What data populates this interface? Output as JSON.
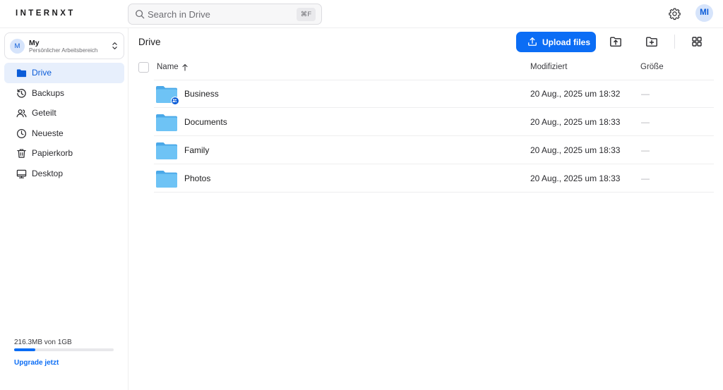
{
  "app": {
    "logo": "INTERNXT",
    "search": {
      "placeholder": "Search in Drive",
      "shortcut": "⌘F"
    },
    "user_initials": "MI",
    "icons": {
      "search": "search-icon",
      "settings": "gear-icon"
    }
  },
  "workspace": {
    "initial": "M",
    "name": "My",
    "subtitle": "Persönlicher Arbeitsbereich",
    "icon": "chevron-up-down-icon"
  },
  "sidebar": {
    "items": [
      {
        "label": "Drive",
        "icon": "folder-icon",
        "active": true
      },
      {
        "label": "Backups",
        "icon": "history-icon",
        "active": false
      },
      {
        "label": "Geteilt",
        "icon": "users-icon",
        "active": false
      },
      {
        "label": "Neueste",
        "icon": "clock-icon",
        "active": false
      },
      {
        "label": "Papierkorb",
        "icon": "trash-icon",
        "active": false
      },
      {
        "label": "Desktop",
        "icon": "monitor-icon",
        "active": false
      }
    ],
    "usage": {
      "text": "216.3MB von 1GB",
      "fraction": 0.2163
    },
    "upgrade_label": "Upgrade jetzt"
  },
  "main": {
    "title": "Drive",
    "upload_label": "Upload files",
    "toolbar_icons": [
      "upload-folder-icon",
      "new-folder-icon",
      "grid-view-icon"
    ],
    "columns": {
      "name": "Name",
      "modified": "Modifiziert",
      "size": "Größe"
    },
    "sort_icon": "arrow-up-icon",
    "files": [
      {
        "name": "Business",
        "modified": "20 Aug., 2025 um 18:32",
        "size": "—",
        "shared": true
      },
      {
        "name": "Documents",
        "modified": "20 Aug., 2025 um 18:33",
        "size": "—",
        "shared": false
      },
      {
        "name": "Family",
        "modified": "20 Aug., 2025 um 18:33",
        "size": "—",
        "shared": false
      },
      {
        "name": "Photos",
        "modified": "20 Aug., 2025 um 18:33",
        "size": "—",
        "shared": false
      }
    ]
  },
  "colors": {
    "accent": "#0B6DF5",
    "active_bg": "#E7EFFC",
    "folder": "#6EC3F5"
  }
}
